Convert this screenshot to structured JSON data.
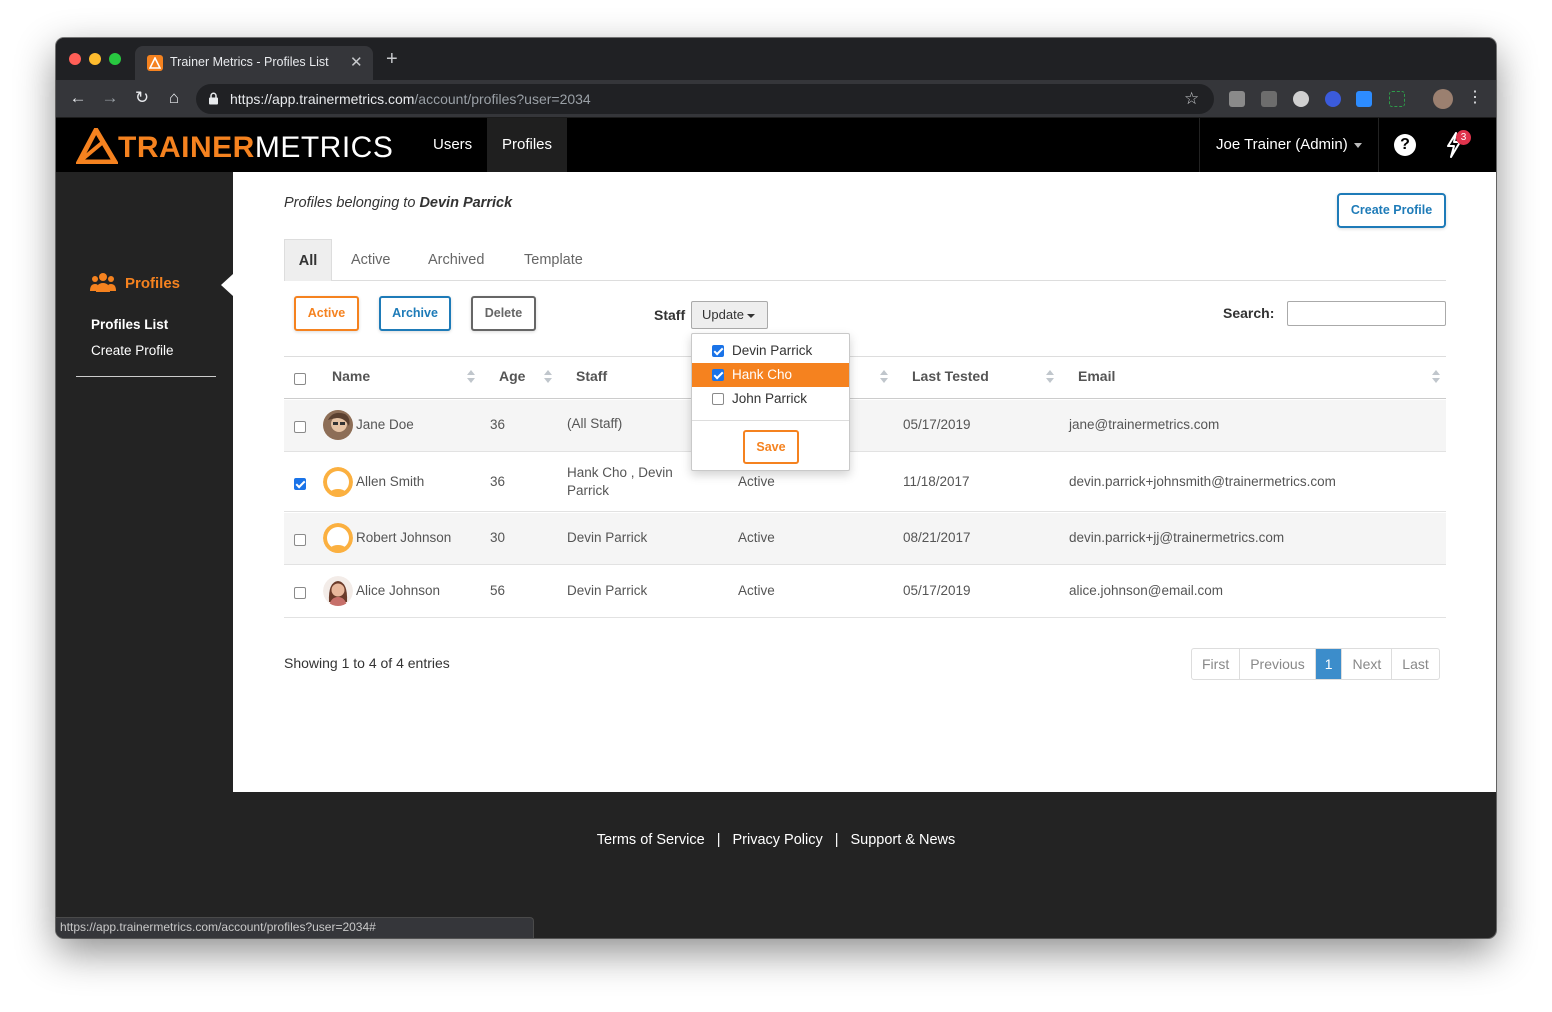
{
  "browser": {
    "tab_title": "Trainer Metrics - Profiles List",
    "url_scheme": "https://",
    "url_host": "app.trainermetrics.com",
    "url_path": "/account/profiles?user=2034",
    "status_url": "https://app.trainermetrics.com/account/profiles?user=2034#"
  },
  "header": {
    "logo_part1": "TRAINER",
    "logo_part2": "METRICS",
    "nav": [
      {
        "label": "Users"
      },
      {
        "label": "Profiles"
      }
    ],
    "user_menu": "Joe Trainer (Admin)",
    "notification_count": "3"
  },
  "sidebar": {
    "section": "Profiles",
    "links": [
      {
        "label": "Profiles List"
      },
      {
        "label": "Create Profile"
      }
    ]
  },
  "main": {
    "subtitle_prefix": "Profiles belonging to",
    "subtitle_owner": "Devin Parrick",
    "create_button": "Create Profile",
    "tabs": [
      {
        "label": "All"
      },
      {
        "label": "Active"
      },
      {
        "label": "Archived"
      },
      {
        "label": "Template"
      }
    ],
    "actions": {
      "active": "Active",
      "archive": "Archive",
      "delete": "Delete"
    },
    "staff_label": "Staff",
    "update_button": "Update",
    "search_label": "Search:",
    "search_value": ""
  },
  "table": {
    "columns": [
      "Name",
      "Age",
      "Staff",
      "",
      "Last Tested",
      "Email"
    ],
    "rows": [
      {
        "name": "Jane Doe",
        "age": "36",
        "staff": "(All Staff)",
        "status": "",
        "last_tested": "05/17/2019",
        "email": "jane@trainermetrics.com",
        "checked": false
      },
      {
        "name": "Allen Smith",
        "age": "36",
        "staff_line1": "Hank Cho , Devin",
        "staff_line2": "Parrick",
        "status": "Active",
        "last_tested": "11/18/2017",
        "email": "devin.parrick+johnsmith@trainermetrics.com",
        "checked": true
      },
      {
        "name": "Robert Johnson",
        "age": "30",
        "staff": "Devin Parrick",
        "status": "Active",
        "last_tested": "08/21/2017",
        "email": "devin.parrick+jj@trainermetrics.com",
        "checked": false
      },
      {
        "name": "Alice Johnson",
        "age": "56",
        "staff": "Devin Parrick",
        "status": "Active",
        "last_tested": "05/17/2019",
        "email": "alice.johnson@email.com",
        "checked": false
      }
    ]
  },
  "staff_dropdown": {
    "options": [
      {
        "label": "Devin Parrick",
        "checked": true
      },
      {
        "label": "Hank Cho",
        "checked": true,
        "highlighted": true
      },
      {
        "label": "John Parrick",
        "checked": false
      }
    ],
    "save_button": "Save"
  },
  "pagination": {
    "info": "Showing 1 to 4 of 4 entries",
    "first": "First",
    "previous": "Previous",
    "current": "1",
    "next": "Next",
    "last": "Last"
  },
  "footer": {
    "links": [
      "Terms of Service",
      "Privacy Policy",
      "Support & News"
    ],
    "separator": "|"
  },
  "colors": {
    "brand_orange": "#f5821f",
    "brand_blue": "#1e7bb8",
    "header_bg": "#000000",
    "page_bg": "#232323",
    "pager_active": "#3c8dcb"
  }
}
